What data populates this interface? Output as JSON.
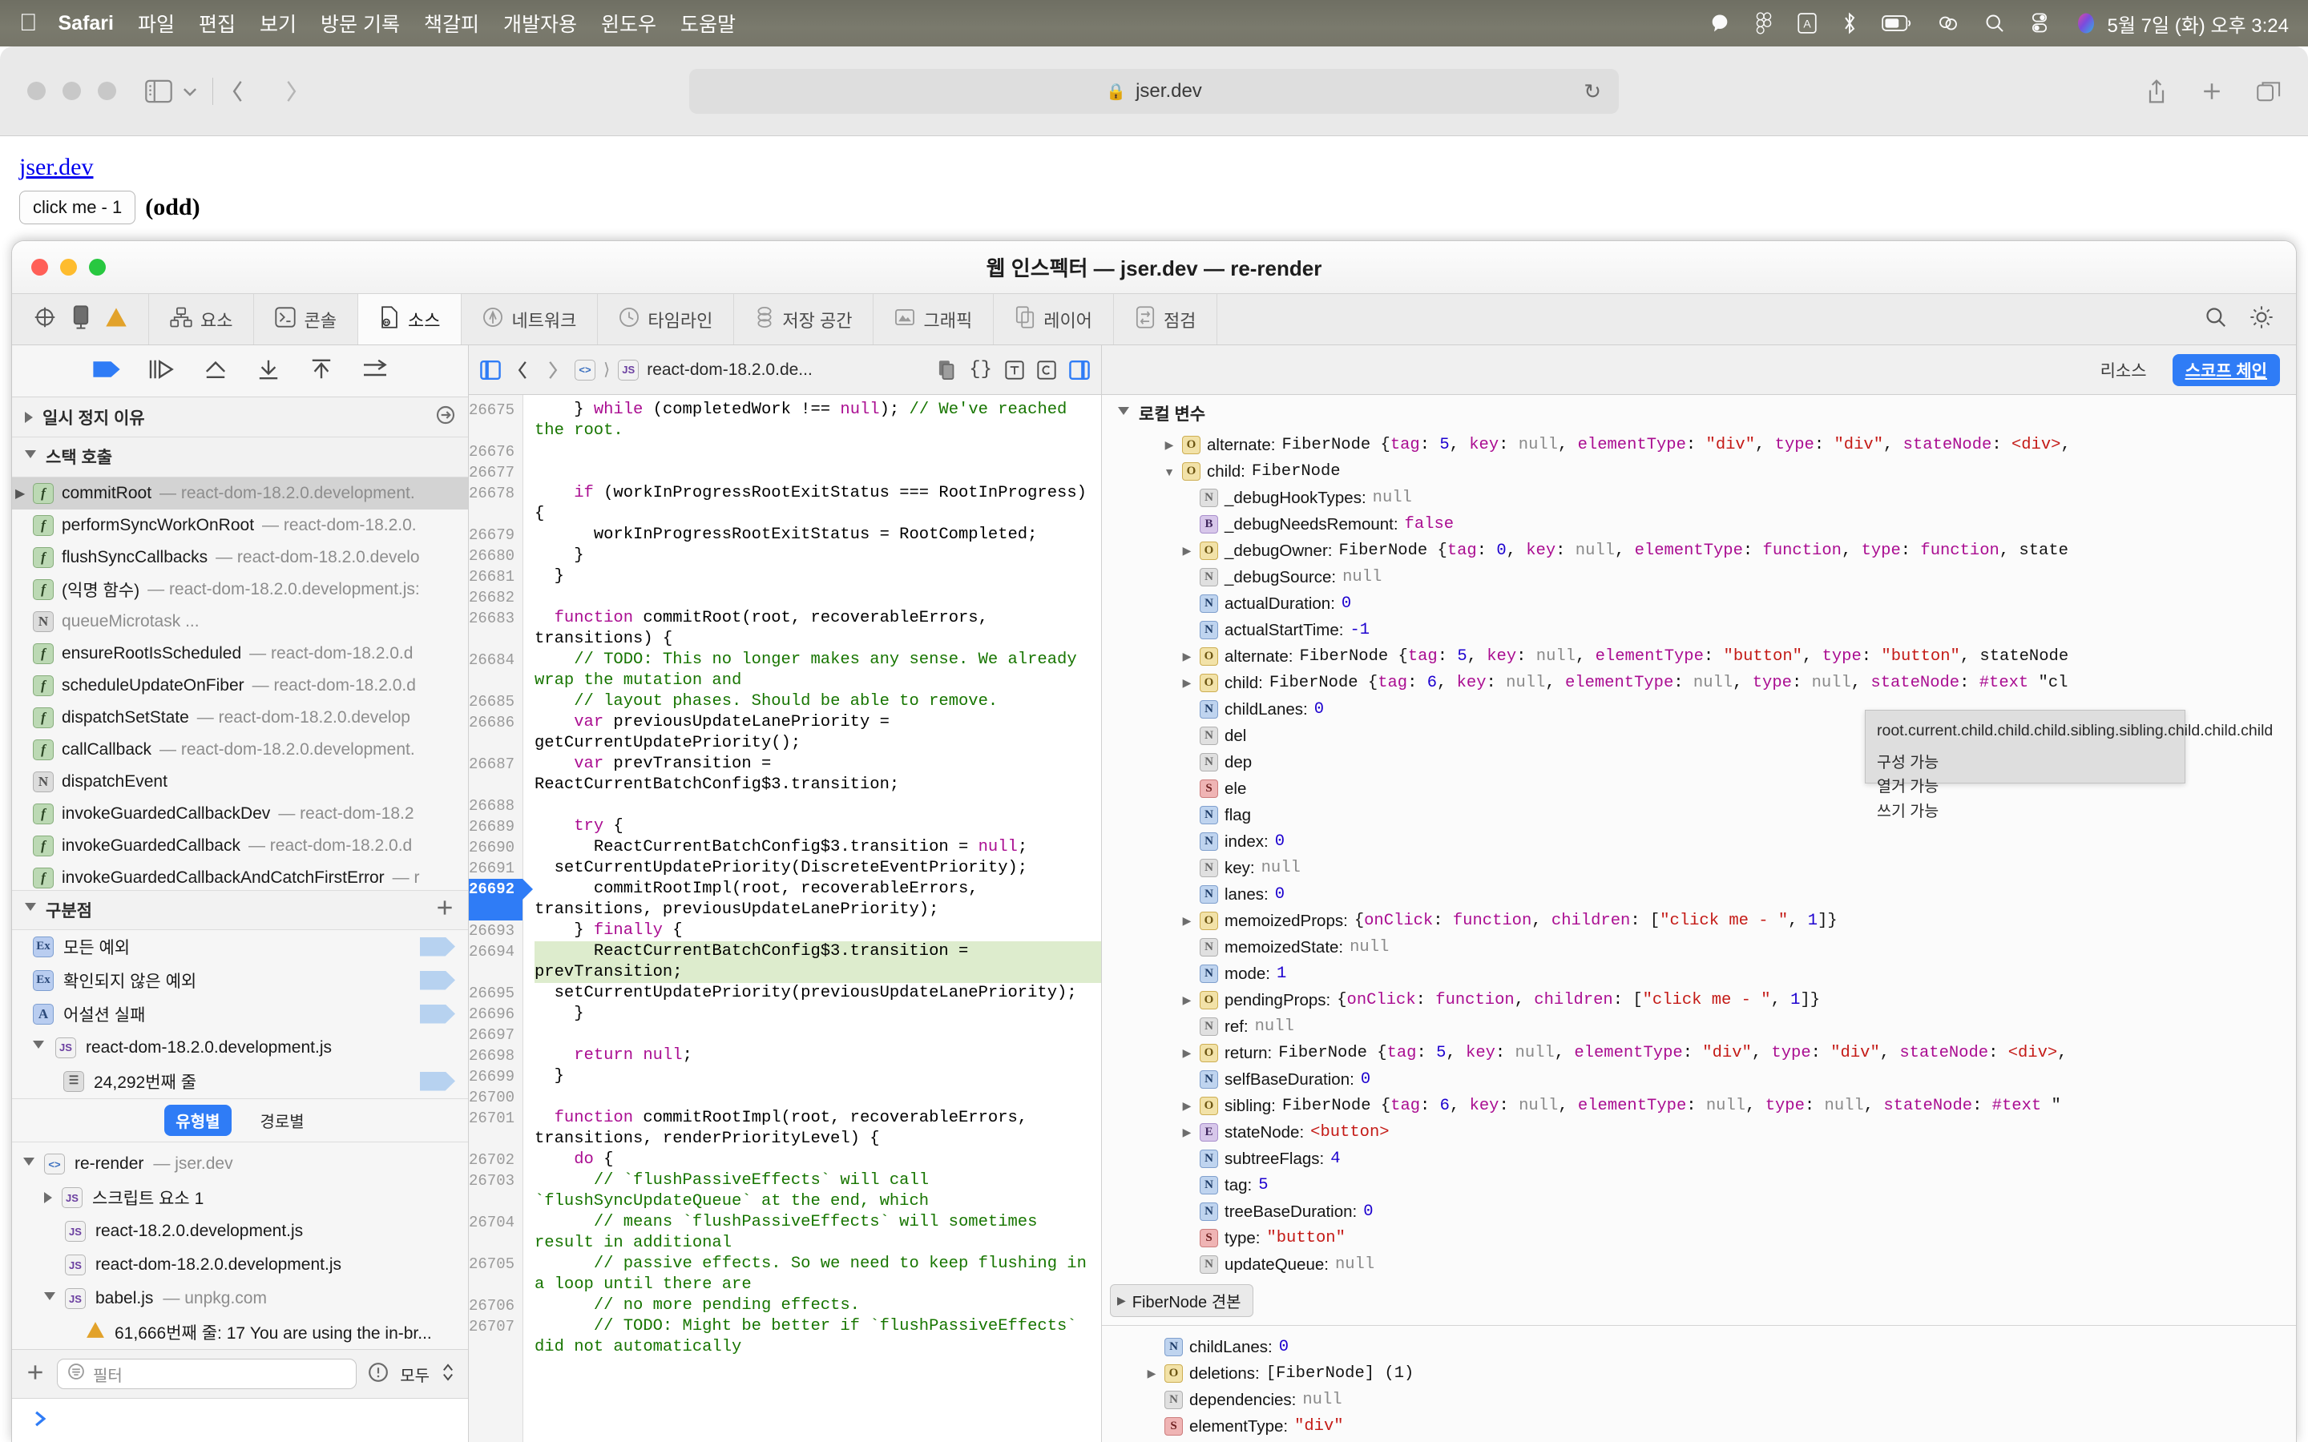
{
  "menubar": {
    "apple_icon": "apple-logo-icon",
    "items": [
      {
        "label": "Safari",
        "bold": true
      },
      {
        "label": "파일",
        "bold": false
      },
      {
        "label": "편집",
        "bold": false
      },
      {
        "label": "보기",
        "bold": false
      },
      {
        "label": "방문 기록",
        "bold": false
      },
      {
        "label": "책갈피",
        "bold": false
      },
      {
        "label": "개발자용",
        "bold": false
      },
      {
        "label": "윈도우",
        "bold": false
      },
      {
        "label": "도움말",
        "bold": false
      }
    ],
    "status_icons": [
      "chat-bubble-icon",
      "figma-icon",
      "input-source-A-icon",
      "bluetooth-icon",
      "battery-icon",
      "control-center-icon",
      "spotlight-search-icon",
      "toggles-icon",
      "siri-icon"
    ],
    "clock": "5월 7일 (화) 오후 3:24"
  },
  "safari": {
    "traffic_lights": [
      "close",
      "minimize",
      "zoom"
    ],
    "sidebar_icon": "sidebar-toggle-icon",
    "chevron_icon": "chevron-down-icon",
    "back_icon": "back-chevron-icon",
    "forward_icon": "forward-chevron-icon",
    "url": "jser.dev",
    "lock_icon": "lock-icon",
    "reload_icon": "reload-icon",
    "share_icon": "share-icon",
    "new_tab_icon": "plus-icon",
    "tab_overview_icon": "tab-overview-icon"
  },
  "page": {
    "link": "jser.dev",
    "button_label": "click me - 1",
    "parity": "(odd)",
    "semicolon": ";"
  },
  "inspector": {
    "title": "웹 인스펙터 — jser.dev — re-render",
    "traffic_lights": [
      {
        "name": "close",
        "color": "#ff5f57"
      },
      {
        "name": "minimize",
        "color": "#febc2e"
      },
      {
        "name": "zoom",
        "color": "#28c840"
      }
    ],
    "toolbar_icons": [
      "inspect-element-icon",
      "device-icon",
      "warning-icon"
    ],
    "tabs": [
      {
        "label": "요소",
        "icon": "elements-icon",
        "selected": false
      },
      {
        "label": "콘솔",
        "icon": "console-icon",
        "selected": false
      },
      {
        "label": "소스",
        "icon": "sources-icon",
        "selected": true
      },
      {
        "label": "네트워크",
        "icon": "network-icon",
        "selected": false
      },
      {
        "label": "타임라인",
        "icon": "timeline-icon",
        "selected": false
      },
      {
        "label": "저장 공간",
        "icon": "storage-icon",
        "selected": false
      },
      {
        "label": "그래픽",
        "icon": "graphics-icon",
        "selected": false
      },
      {
        "label": "레이어",
        "icon": "layers-icon",
        "selected": false
      },
      {
        "label": "점검",
        "icon": "audit-icon",
        "selected": false
      }
    ],
    "tab_right_icons": [
      "search-icon",
      "settings-gear-icon"
    ]
  },
  "debugger": {
    "controls": [
      "resume-icon",
      "step-over-icon",
      "step-into-icon",
      "step-out-icon",
      "step-up-icon",
      "continue-to-here-icon"
    ],
    "pause_reason_header": "일시 정지 이유",
    "pause_reason_action_icon": "goto-arrow-icon",
    "call_stack_header": "스택 호출",
    "call_stack": [
      {
        "badge": "f",
        "name": "commitRoot",
        "source": " — react-dom-18.2.0.development.",
        "active": true
      },
      {
        "badge": "f",
        "name": "performSyncWorkOnRoot",
        "source": " — react-dom-18.2.0.",
        "active": false
      },
      {
        "badge": "f",
        "name": "flushSyncCallbacks",
        "source": " — react-dom-18.2.0.develo",
        "active": false
      },
      {
        "badge": "f",
        "name": "(익명 함수)",
        "source": " — react-dom-18.2.0.development.js:",
        "active": false
      },
      {
        "badge": "N",
        "name": "queueMicrotask ...",
        "source": "",
        "active": false,
        "dim": true
      },
      {
        "badge": "f",
        "name": "ensureRootIsScheduled",
        "source": " — react-dom-18.2.0.d",
        "active": false
      },
      {
        "badge": "f",
        "name": "scheduleUpdateOnFiber",
        "source": " — react-dom-18.2.0.d",
        "active": false
      },
      {
        "badge": "f",
        "name": "dispatchSetState",
        "source": " — react-dom-18.2.0.develop",
        "active": false
      },
      {
        "badge": "f",
        "name": "callCallback",
        "source": " — react-dom-18.2.0.development.",
        "active": false
      },
      {
        "badge": "N",
        "name": "dispatchEvent",
        "source": "",
        "active": false
      },
      {
        "badge": "f",
        "name": "invokeGuardedCallbackDev",
        "source": " — react-dom-18.2",
        "active": false
      },
      {
        "badge": "f",
        "name": "invokeGuardedCallback",
        "source": " — react-dom-18.2.0.d",
        "active": false
      },
      {
        "badge": "f",
        "name": "invokeGuardedCallbackAndCatchFirstError",
        "source": " — r",
        "active": false
      }
    ],
    "breakpoints_header": "구분점",
    "add_breakpoint_icon": "plus-icon",
    "breakpoints": [
      {
        "badge": "Ex",
        "label": "모든 예외",
        "pill": true
      },
      {
        "badge": "Ex",
        "label": "확인되지 않은 예외",
        "pill": true
      },
      {
        "badge": "A",
        "label": "어설션 실패",
        "pill": true
      },
      {
        "badge": "JS",
        "label": "react-dom-18.2.0.development.js",
        "pill": false,
        "expanded": true
      },
      {
        "badge": "LN",
        "label": "24,292번째 줄",
        "pill": true,
        "indent": true
      }
    ],
    "segmented": [
      {
        "label": "유형별",
        "selected": true
      },
      {
        "label": "경로별",
        "selected": false
      }
    ],
    "resources": [
      {
        "badge": "HTML",
        "name": "re-render",
        "suffix": " — jser.dev",
        "depth": 0,
        "expanded": true
      },
      {
        "badge": "JS",
        "name": "스크립트 요소 1",
        "suffix": "",
        "depth": 1,
        "collapsed": true
      },
      {
        "badge": "JS",
        "name": "react-18.2.0.development.js",
        "suffix": "",
        "depth": 1
      },
      {
        "badge": "JS",
        "name": "react-dom-18.2.0.development.js",
        "suffix": "",
        "depth": 1
      },
      {
        "badge": "JS",
        "name": "babel.js",
        "suffix": " — unpkg.com",
        "depth": 1,
        "expanded": true
      },
      {
        "badge": "WARN",
        "name": "61,666번째 줄: 17 You are using the in-br...",
        "suffix": "",
        "depth": 2
      }
    ],
    "filter_placeholder": "필터",
    "filter_add_icon": "plus-icon",
    "filter_icon": "filter-icon",
    "error_icon": "exclamation-circle-icon",
    "scope_select": "모두",
    "console_prompt_icon": "console-prompt-icon"
  },
  "source": {
    "nav_icons_left": [
      "show-navigation-sidebar-icon",
      "back-icon",
      "forward-icon"
    ],
    "breadcrumb": [
      {
        "badge": "HTML",
        "label": ""
      },
      {
        "badge": "JS",
        "label": "react-dom-18.2.0.de..."
      }
    ],
    "nav_icons_right": [
      "copy-icon",
      "pretty-print-icon",
      "show-type-icon",
      "continuous-icon",
      "show-details-sidebar-icon"
    ],
    "first_line_number": 26675,
    "current_line": 26692,
    "highlighted_line": 26694,
    "lines": [
      {
        "n": 26675,
        "text": "    } while (completedWork !== null); // We've reached the root."
      },
      {
        "n": 26676,
        "text": ""
      },
      {
        "n": 26677,
        "text": ""
      },
      {
        "n": 26678,
        "text": "    if (workInProgressRootExitStatus === RootInProgress) {"
      },
      {
        "n": 26679,
        "text": "      workInProgressRootExitStatus = RootCompleted;"
      },
      {
        "n": 26680,
        "text": "    }"
      },
      {
        "n": 26681,
        "text": "  }"
      },
      {
        "n": 26682,
        "text": ""
      },
      {
        "n": 26683,
        "text": "  function commitRoot(root, recoverableErrors, transitions) {"
      },
      {
        "n": 26684,
        "text": "    // TODO: This no longer makes any sense. We already wrap the mutation and"
      },
      {
        "n": 26685,
        "text": "    // layout phases. Should be able to remove."
      },
      {
        "n": 26686,
        "text": "    var previousUpdateLanePriority = getCurrentUpdatePriority();"
      },
      {
        "n": 26687,
        "text": "    var prevTransition = ReactCurrentBatchConfig$3.transition;"
      },
      {
        "n": 26688,
        "text": ""
      },
      {
        "n": 26689,
        "text": "    try {"
      },
      {
        "n": 26690,
        "text": "      ReactCurrentBatchConfig$3.transition = null;"
      },
      {
        "n": 26691,
        "text": "  setCurrentUpdatePriority(DiscreteEventPriority);"
      },
      {
        "n": 26692,
        "text": "      commitRootImpl(root, recoverableErrors, transitions, previousUpdateLanePriority);"
      },
      {
        "n": 26693,
        "text": "    } finally {"
      },
      {
        "n": 26694,
        "text": "      ReactCurrentBatchConfig$3.transition = prevTransition;"
      },
      {
        "n": 26695,
        "text": "  setCurrentUpdatePriority(previousUpdateLanePriority);"
      },
      {
        "n": 26696,
        "text": "    }"
      },
      {
        "n": 26697,
        "text": ""
      },
      {
        "n": 26698,
        "text": "    return null;"
      },
      {
        "n": 26699,
        "text": "  }"
      },
      {
        "n": 26700,
        "text": ""
      },
      {
        "n": 26701,
        "text": "  function commitRootImpl(root, recoverableErrors, transitions, renderPriorityLevel) {"
      },
      {
        "n": 26702,
        "text": "    do {"
      },
      {
        "n": 26703,
        "text": "      // `flushPassiveEffects` will call `flushSyncUpdateQueue` at the end, which"
      },
      {
        "n": 26704,
        "text": "      // means `flushPassiveEffects` will sometimes result in additional"
      },
      {
        "n": 26705,
        "text": "      // passive effects. So we need to keep flushing in a loop until there are"
      },
      {
        "n": 26706,
        "text": "      // no more pending effects."
      },
      {
        "n": 26707,
        "text": "      // TODO: Might be better if `flushPassiveEffects` did not automatically"
      }
    ]
  },
  "scope": {
    "tabs": [
      {
        "label": "리소스",
        "selected": false
      },
      {
        "label": "스코프 체인",
        "selected": true
      }
    ],
    "section_title": "로컬 변수",
    "rows": [
      {
        "badge": "O",
        "arrow": "right",
        "indent": 3,
        "key": "alternate",
        "sep": ": ",
        "value": "FiberNode {tag: 5, key: null, elementType: \"div\", type: \"div\", stateNode: <div>,"
      },
      {
        "badge": "O",
        "arrow": "down",
        "indent": 3,
        "key": "child",
        "sep": ": ",
        "value": "FiberNode"
      },
      {
        "badge": "N",
        "arrow": "none",
        "indent": 4,
        "key": "_debugHookTypes",
        "sep": ": ",
        "value": "null"
      },
      {
        "badge": "B",
        "arrow": "none",
        "indent": 4,
        "key": "_debugNeedsRemount",
        "sep": ": ",
        "value": "false"
      },
      {
        "badge": "O",
        "arrow": "right",
        "indent": 4,
        "key": "_debugOwner",
        "sep": ": ",
        "value": "FiberNode {tag: 0, key: null, elementType: function, type: function, state"
      },
      {
        "badge": "N",
        "arrow": "none",
        "indent": 4,
        "key": "_debugSource",
        "sep": ": ",
        "value": "null"
      },
      {
        "badge": "N",
        "arrow": "none",
        "indent": 4,
        "key": "actualDuration",
        "sep": ": ",
        "value": "0"
      },
      {
        "badge": "N",
        "arrow": "none",
        "indent": 4,
        "key": "actualStartTime",
        "sep": ": ",
        "value": "-1"
      },
      {
        "badge": "O",
        "arrow": "right",
        "indent": 4,
        "key": "alternate",
        "sep": ": ",
        "value": "FiberNode {tag: 5, key: null, elementType: \"button\", type: \"button\", stateNode"
      },
      {
        "badge": "O",
        "arrow": "right",
        "indent": 4,
        "key": "child",
        "sep": ": ",
        "value": "FiberNode {tag: 6, key: null, elementType: null, type: null, stateNode: #text \"cl"
      },
      {
        "badge": "N",
        "arrow": "none",
        "indent": 4,
        "key": "childLanes",
        "sep": ": ",
        "value": "0"
      },
      {
        "badge": "N",
        "arrow": "none",
        "indent": 4,
        "key": "del",
        "sep": "",
        "value": ""
      },
      {
        "badge": "N",
        "arrow": "none",
        "indent": 4,
        "key": "dep",
        "sep": "",
        "value": ""
      },
      {
        "badge": "S",
        "arrow": "none",
        "indent": 4,
        "key": "ele",
        "sep": "",
        "value": ""
      },
      {
        "badge": "N",
        "arrow": "none",
        "indent": 4,
        "key": "flag",
        "sep": "",
        "value": ""
      },
      {
        "badge": "N",
        "arrow": "none",
        "indent": 4,
        "key": "index",
        "sep": ": ",
        "value": "0"
      },
      {
        "badge": "N",
        "arrow": "none",
        "indent": 4,
        "key": "key",
        "sep": ": ",
        "value": "null"
      },
      {
        "badge": "N",
        "arrow": "none",
        "indent": 4,
        "key": "lanes",
        "sep": ": ",
        "value": "0"
      },
      {
        "badge": "O",
        "arrow": "right",
        "indent": 4,
        "key": "memoizedProps",
        "sep": ": ",
        "value": "{onClick: function, children: [\"click me - \", 1]}"
      },
      {
        "badge": "N",
        "arrow": "none",
        "indent": 4,
        "key": "memoizedState",
        "sep": ": ",
        "value": "null"
      },
      {
        "badge": "N",
        "arrow": "none",
        "indent": 4,
        "key": "mode",
        "sep": ": ",
        "value": "1"
      },
      {
        "badge": "O",
        "arrow": "right",
        "indent": 4,
        "key": "pendingProps",
        "sep": ": ",
        "value": "{onClick: function, children: [\"click me - \", 1]}"
      },
      {
        "badge": "N",
        "arrow": "none",
        "indent": 4,
        "key": "ref",
        "sep": ": ",
        "value": "null"
      },
      {
        "badge": "O",
        "arrow": "right",
        "indent": 4,
        "key": "return",
        "sep": ": ",
        "value": "FiberNode {tag: 5, key: null, elementType: \"div\", type: \"div\", stateNode: <div>,"
      },
      {
        "badge": "N",
        "arrow": "none",
        "indent": 4,
        "key": "selfBaseDuration",
        "sep": ": ",
        "value": "0"
      },
      {
        "badge": "O",
        "arrow": "right",
        "indent": 4,
        "key": "sibling",
        "sep": ": ",
        "value": "FiberNode {tag: 6, key: null, elementType: null, type: null, stateNode: #text \""
      },
      {
        "badge": "E",
        "arrow": "right",
        "indent": 4,
        "key": "stateNode",
        "sep": ": ",
        "value": "<button>"
      },
      {
        "badge": "N",
        "arrow": "none",
        "indent": 4,
        "key": "subtreeFlags",
        "sep": ": ",
        "value": "4"
      },
      {
        "badge": "N",
        "arrow": "none",
        "indent": 4,
        "key": "tag",
        "sep": ": ",
        "value": "5"
      },
      {
        "badge": "N",
        "arrow": "none",
        "indent": 4,
        "key": "treeBaseDuration",
        "sep": ": ",
        "value": "0"
      },
      {
        "badge": "S",
        "arrow": "none",
        "indent": 4,
        "key": "type",
        "sep": ": ",
        "value": "\"button\""
      },
      {
        "badge": "N",
        "arrow": "none",
        "indent": 4,
        "key": "updateQueue",
        "sep": ": ",
        "value": "null"
      }
    ],
    "sample_label": "FiberNode 견본",
    "rows_after": [
      {
        "badge": "N",
        "arrow": "none",
        "indent": 2,
        "key": "childLanes",
        "sep": ": ",
        "value": "0"
      },
      {
        "badge": "O",
        "arrow": "right",
        "indent": 2,
        "key": "deletions",
        "sep": ": ",
        "value": "[FiberNode] (1)"
      },
      {
        "badge": "N",
        "arrow": "none",
        "indent": 2,
        "key": "dependencies",
        "sep": ": ",
        "value": "null"
      },
      {
        "badge": "S",
        "arrow": "none",
        "indent": 2,
        "key": "elementType",
        "sep": ": ",
        "value": "\"div\""
      }
    ]
  },
  "tooltip": {
    "path": "root.current.child.child.child.sibling.sibling.child.child.child",
    "attributes": [
      "구성 가능",
      "열거 가능",
      "쓰기 가능"
    ]
  }
}
